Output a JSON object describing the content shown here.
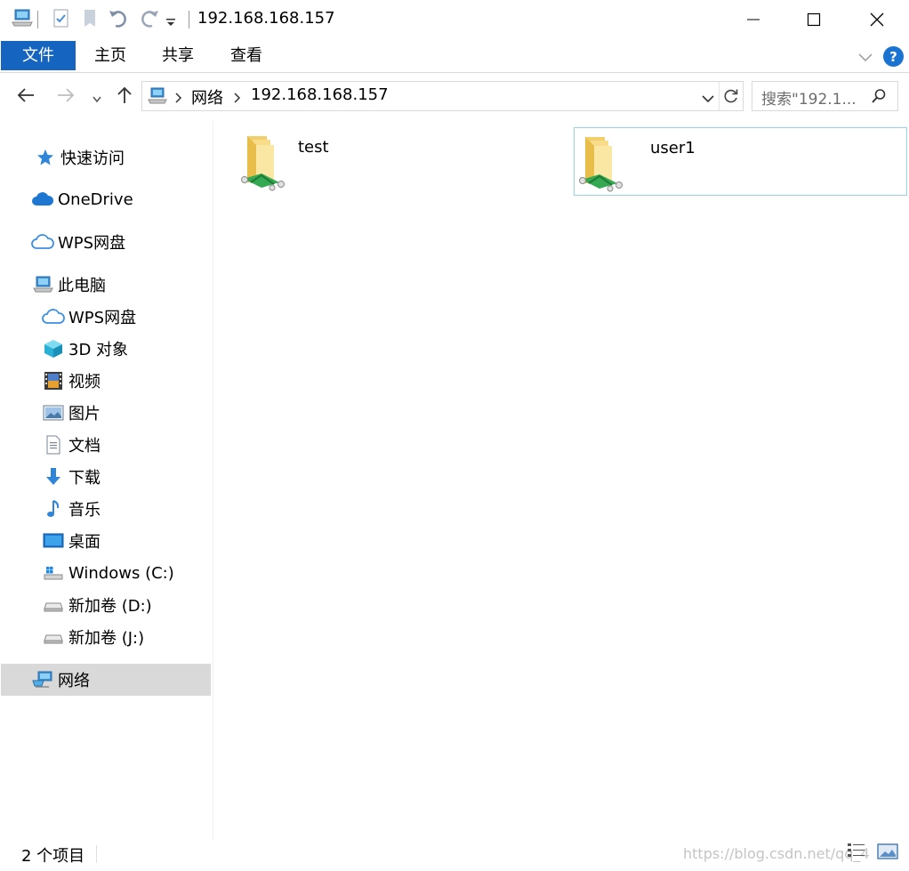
{
  "window": {
    "title": "192.168.168.157",
    "controls": [
      "minimize",
      "maximize",
      "close"
    ]
  },
  "quick_access_toolbar": [
    "computer-icon",
    "properties-icon",
    "new-folder-icon",
    "undo-icon",
    "redo-icon",
    "customize-dropdown-icon"
  ],
  "ribbon": {
    "tabs": [
      "文件",
      "主页",
      "共享",
      "查看"
    ],
    "active_tab": "文件",
    "accent": "#1565c0"
  },
  "address": {
    "segments": [
      "网络",
      "192.168.168.157"
    ],
    "search_placeholder": "搜索\"192.1..."
  },
  "nav_pane": {
    "quick_access": "快速访问",
    "onedrive": "OneDrive",
    "wps_top": "WPS网盘",
    "this_pc": "此电脑",
    "children": [
      "WPS网盘",
      "3D 对象",
      "视频",
      "图片",
      "文档",
      "下载",
      "音乐",
      "桌面",
      "Windows (C:)",
      "新加卷 (D:)",
      "新加卷 (J:)"
    ],
    "network": "网络",
    "selected": "网络"
  },
  "content": {
    "items": [
      {
        "name": "test",
        "type": "shared-folder"
      },
      {
        "name": "user1",
        "type": "shared-folder",
        "hover": true
      }
    ]
  },
  "status": {
    "item_count": "2 个项目",
    "watermark": "https://blog.csdn.net/qq_4"
  }
}
